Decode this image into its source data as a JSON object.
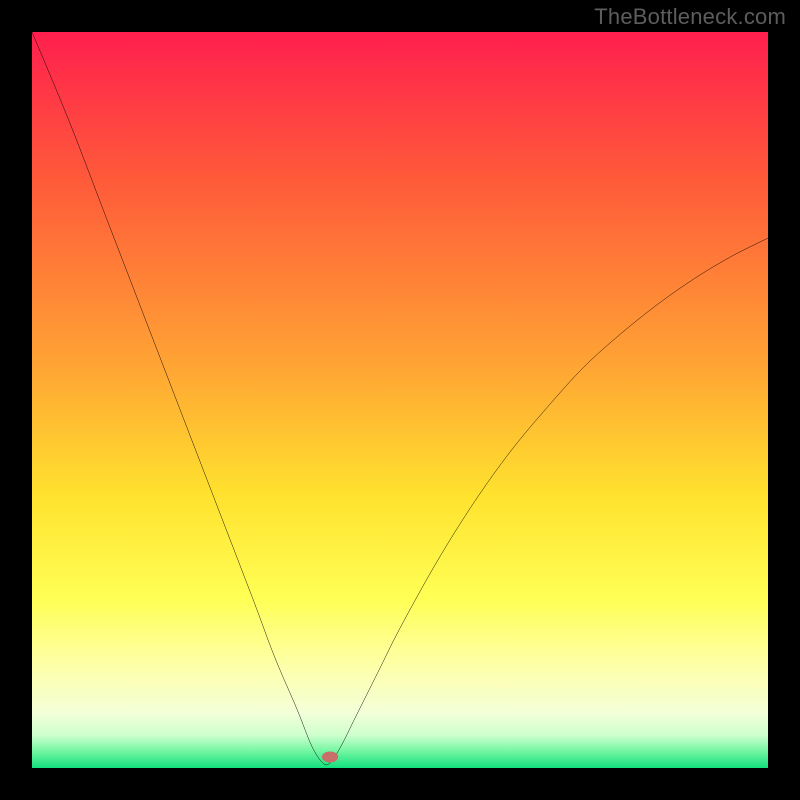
{
  "watermark": "TheBottleneck.com",
  "chart_data": {
    "type": "line",
    "title": "",
    "xlabel": "",
    "ylabel": "",
    "xlim": [
      0,
      100
    ],
    "ylim": [
      0,
      100
    ],
    "grid": false,
    "legend": false,
    "annotations": [],
    "optimum_x": 40,
    "marker": {
      "x": 40.5,
      "y": 1.5,
      "color": "#c86f6a"
    },
    "gradient_stops": [
      {
        "offset": 0.0,
        "color": "#ff1f4e"
      },
      {
        "offset": 0.2,
        "color": "#ff5a3a"
      },
      {
        "offset": 0.45,
        "color": "#ffa334"
      },
      {
        "offset": 0.63,
        "color": "#ffe22e"
      },
      {
        "offset": 0.77,
        "color": "#ffff55"
      },
      {
        "offset": 0.87,
        "color": "#fdffb0"
      },
      {
        "offset": 0.925,
        "color": "#f3ffd8"
      },
      {
        "offset": 0.955,
        "color": "#cfffce"
      },
      {
        "offset": 0.975,
        "color": "#7cf7a6"
      },
      {
        "offset": 1.0,
        "color": "#13e07d"
      }
    ],
    "series": [
      {
        "name": "bottleneck-curve",
        "x": [
          0,
          5,
          10,
          15,
          20,
          25,
          30,
          33,
          36,
          38,
          39.5,
          40.5,
          42,
          44,
          47,
          50,
          55,
          60,
          65,
          70,
          75,
          80,
          85,
          90,
          95,
          100
        ],
        "y": [
          100,
          88,
          75,
          62,
          49,
          36,
          23,
          15,
          8,
          3,
          0.7,
          0.7,
          3,
          7,
          13,
          19,
          28,
          36,
          43,
          49,
          54.5,
          59,
          63,
          66.5,
          69.5,
          72
        ]
      }
    ]
  }
}
